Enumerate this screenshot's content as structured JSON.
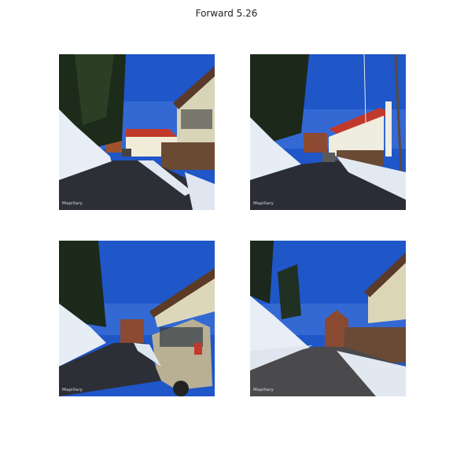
{
  "figure": {
    "title": "Forward 5.26"
  },
  "images": [
    {
      "id": "p1",
      "watermark": "Mapillary"
    },
    {
      "id": "p2",
      "watermark": "Mapillary"
    },
    {
      "id": "p3",
      "watermark": "Mapillary"
    },
    {
      "id": "p4",
      "watermark": "Mapillary"
    }
  ]
}
